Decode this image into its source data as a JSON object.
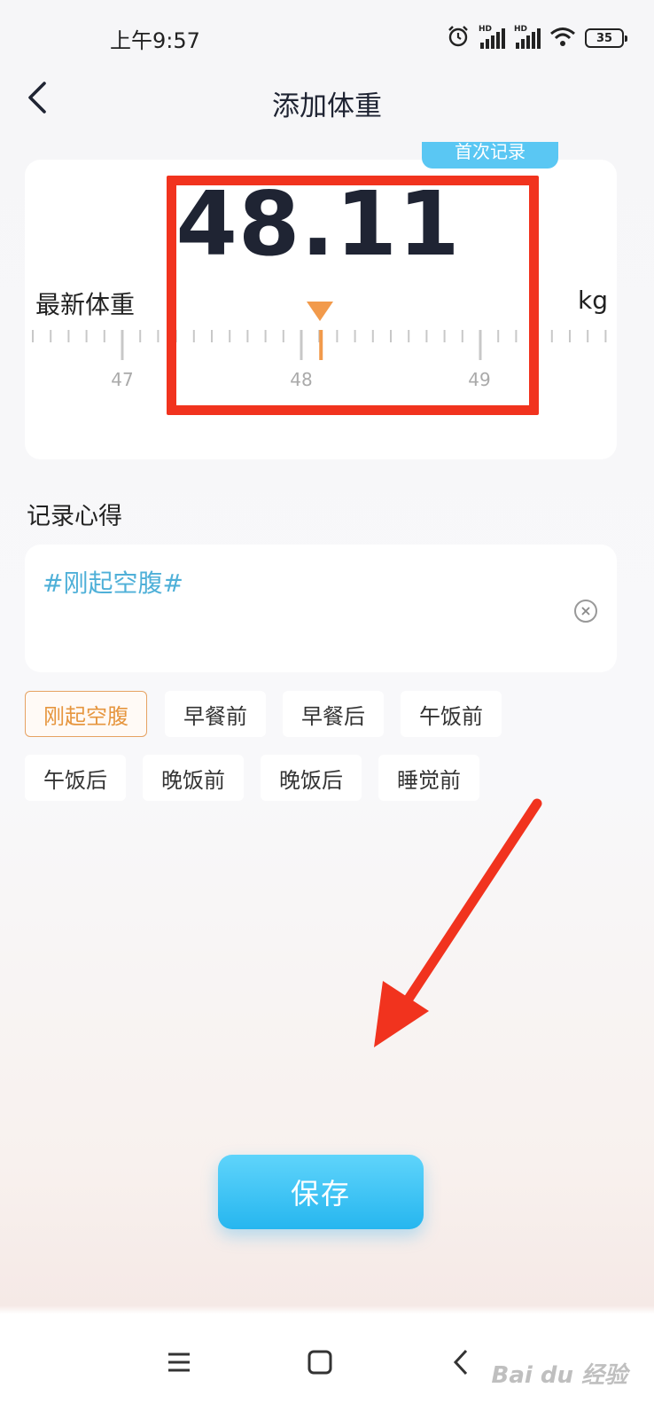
{
  "status_bar": {
    "time": "上午9:57",
    "battery": "35",
    "network_badge": "HD",
    "icons": [
      "alarm-icon",
      "signal-icon",
      "signal-icon",
      "wifi-icon",
      "battery-icon"
    ]
  },
  "header": {
    "title": "添加体重",
    "back_icon": "chevron-left-icon"
  },
  "weight": {
    "badge": "首次记录",
    "value": "48.11",
    "label": "最新体重",
    "unit": "kg",
    "ruler": {
      "min": 47,
      "max": 49,
      "current": 48.11,
      "labels": [
        "47",
        "48",
        "49"
      ]
    }
  },
  "note": {
    "label": "记录心得",
    "text": "#刚起空腹#",
    "clear_icon": "close-circle-icon"
  },
  "tags": [
    {
      "label": "刚起空腹",
      "active": true
    },
    {
      "label": "早餐前",
      "active": false
    },
    {
      "label": "早餐后",
      "active": false
    },
    {
      "label": "午饭前",
      "active": false
    },
    {
      "label": "午饭后",
      "active": false
    },
    {
      "label": "晚饭前",
      "active": false
    },
    {
      "label": "晚饭后",
      "active": false
    },
    {
      "label": "睡觉前",
      "active": false
    }
  ],
  "save_button": {
    "label": "保存"
  },
  "nav": {
    "menu_icon": "menu-icon",
    "home_icon": "home-square-icon",
    "back_icon": "back-chevron-icon"
  },
  "watermark": "Bai du 经验",
  "colors": {
    "accent": "#26b6ef",
    "tag_active": "#e6963f",
    "pointer": "#f29a4b",
    "annotation": "#f1331e",
    "note_text": "#4fb0d8"
  }
}
